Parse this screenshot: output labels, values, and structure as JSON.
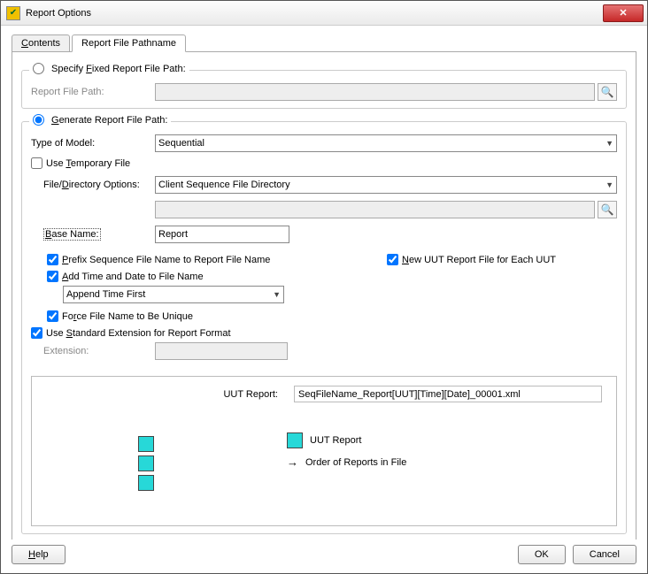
{
  "window": {
    "title": "Report Options"
  },
  "tabs": {
    "contents": "Contents",
    "pathname": "Report File Pathname"
  },
  "specify": {
    "legend": "Specify Fixed Report File Path:",
    "path_label": "Report File Path:"
  },
  "generate": {
    "legend": "Generate Report File Path:",
    "type_of_model_label": "Type of Model:",
    "type_of_model_value": "Sequential",
    "use_temp_file": "Use Temporary File",
    "file_dir_label": "File/Directory Options:",
    "file_dir_value": "Client Sequence File Directory",
    "base_name_label": "Base Name:",
    "base_name_value": "Report",
    "prefix_seq": "Prefix Sequence File Name to Report File Name",
    "new_uut": "New UUT Report File for Each UUT",
    "add_time": "Add Time and Date to File Name",
    "append_time_value": "Append Time First",
    "force_unique": "Force File Name to Be Unique",
    "use_std_ext": "Use Standard Extension for Report Format",
    "extension_label": "Extension:"
  },
  "preview": {
    "uut_report_label": "UUT Report:",
    "uut_report_value": "SeqFileName_Report[UUT][Time][Date]_00001.xml",
    "legend_uut": "UUT Report",
    "legend_order": "Order of Reports in File"
  },
  "buttons": {
    "help": "Help",
    "ok": "OK",
    "cancel": "Cancel"
  }
}
